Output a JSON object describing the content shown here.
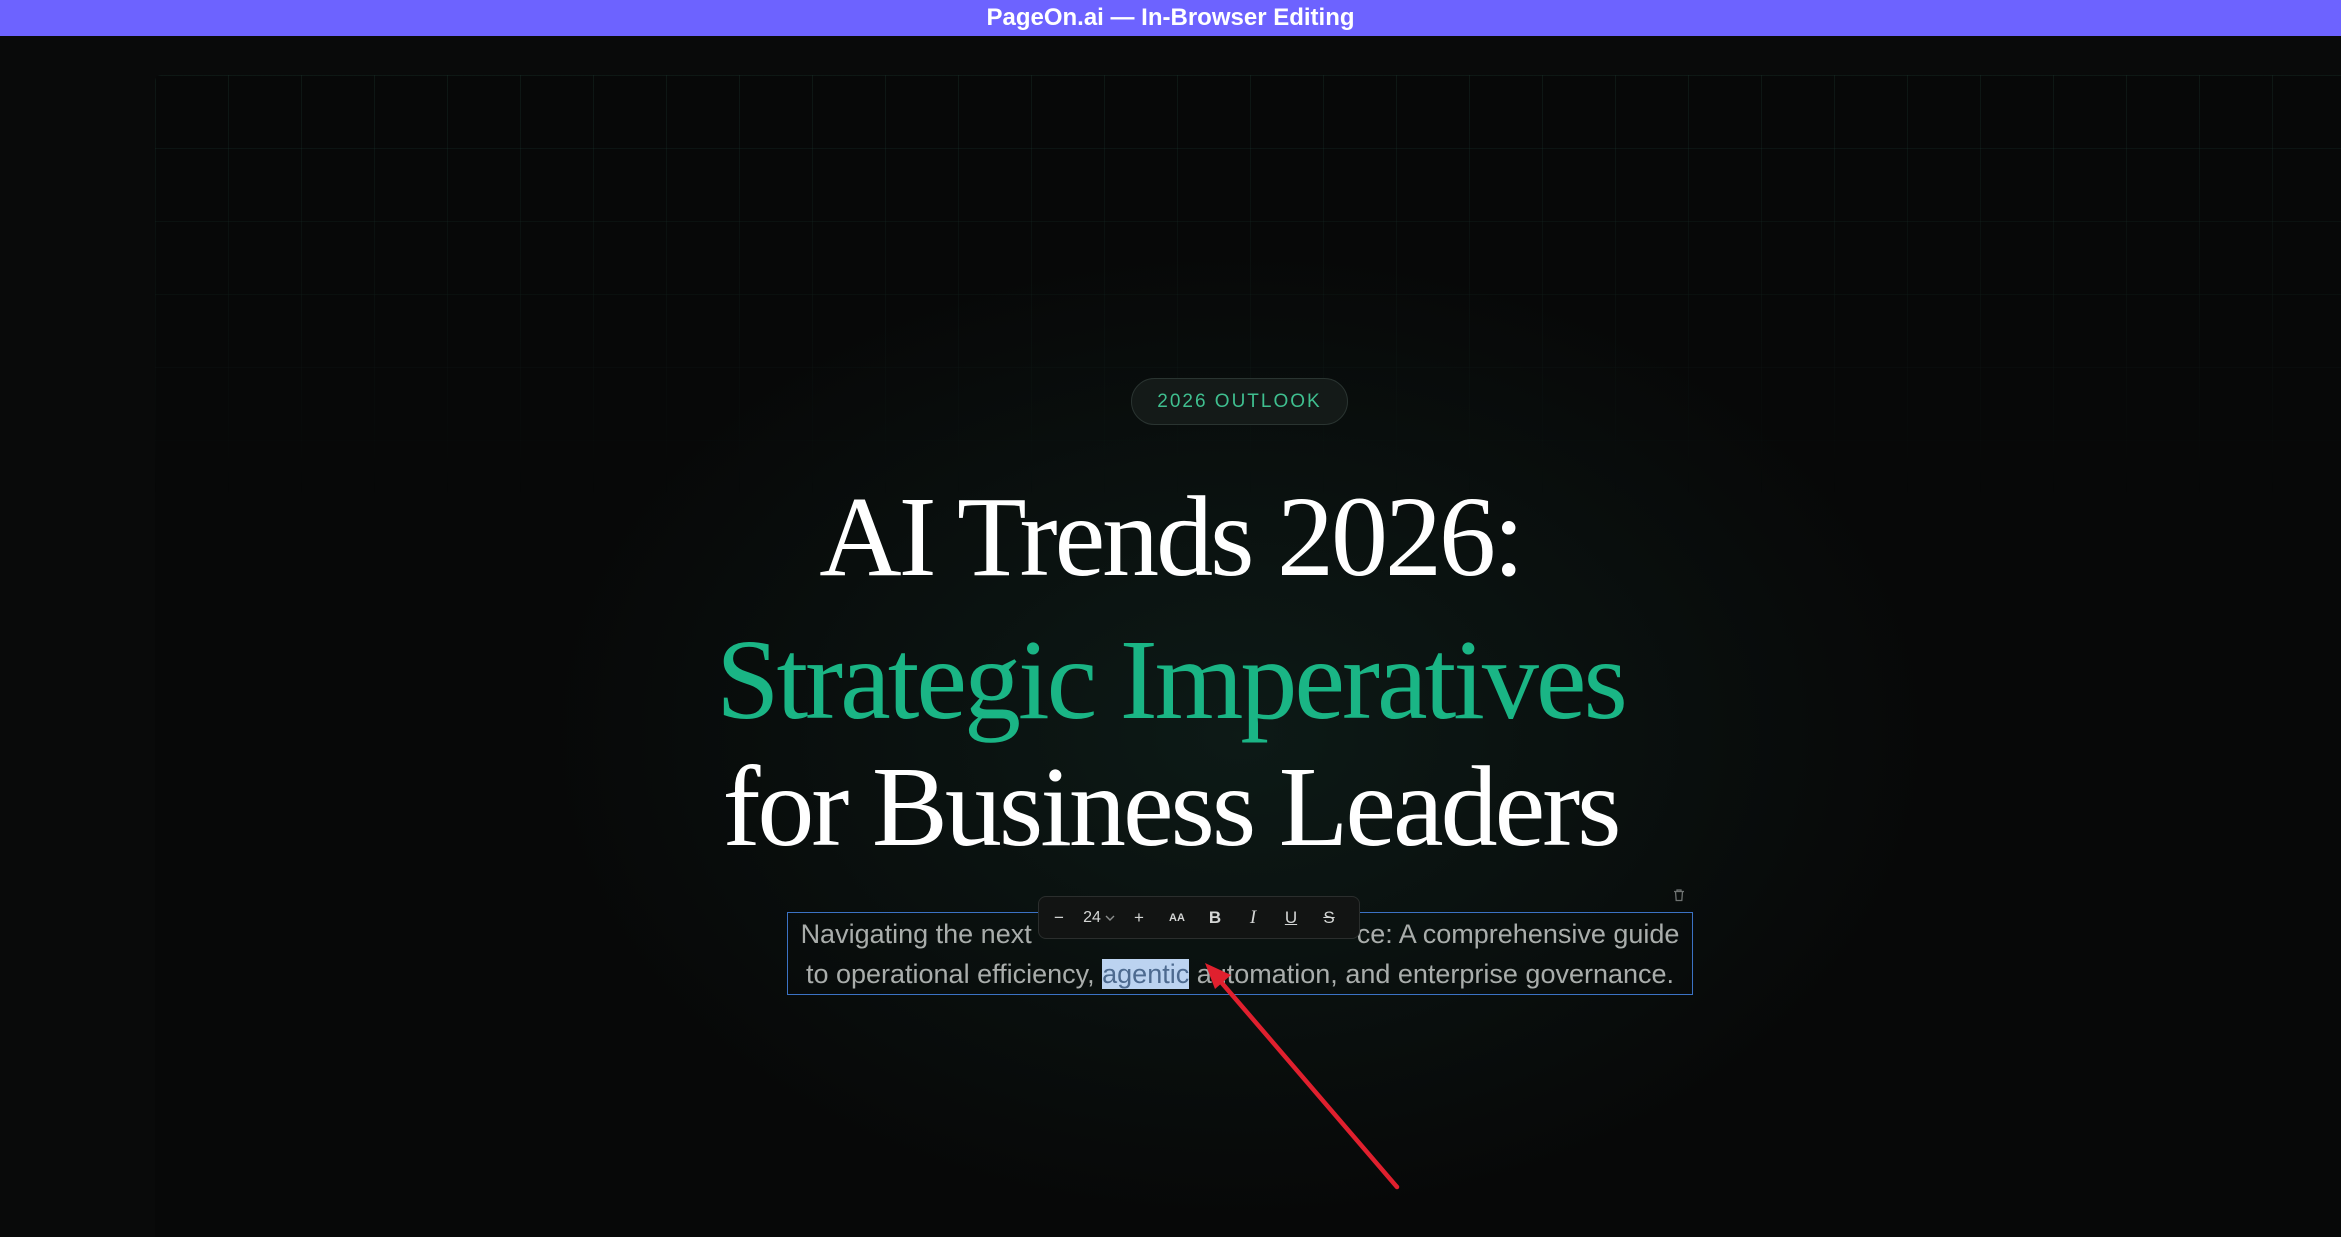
{
  "window": {
    "title": "PageOn.ai — In-Browser Editing"
  },
  "slide": {
    "badge": "2026 OUTLOOK",
    "title_line1": "AI Trends 2026:",
    "title_line2": "Strategic Imperatives",
    "title_line3": "for Business Leaders",
    "subtitle": {
      "line1_start": "Navigating the next",
      "line1_end": "ce: A comprehensive guide",
      "line2_before": "to operational efficiency, ",
      "line2_selected": "agentic",
      "line2_after": " automation, and enterprise governance."
    }
  },
  "toolbar": {
    "decrease": "−",
    "font_size": "24",
    "increase": "+",
    "case_label": "AA",
    "bold_label": "B",
    "italic_label": "I",
    "underline_label": "U",
    "strike_label": "S"
  },
  "icons": {
    "chevron": "chevron-down-icon",
    "trash": "trash-icon",
    "arrow": "annotation-arrow"
  },
  "colors": {
    "topbar": "#6d63ff",
    "accent_green": "#1ab585",
    "selection_border": "#3b72c4",
    "annotation_arrow": "#e0202e"
  }
}
